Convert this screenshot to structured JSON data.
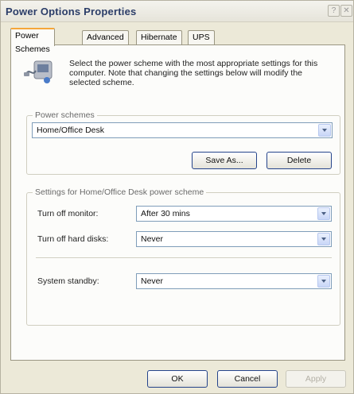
{
  "window": {
    "title": "Power Options Properties",
    "help_glyph": "?",
    "close_glyph": "✕"
  },
  "tabs": [
    {
      "label": "Power Schemes"
    },
    {
      "label": "Advanced"
    },
    {
      "label": "Hibernate"
    },
    {
      "label": "UPS"
    }
  ],
  "intro": {
    "icon": "power-plug-icon",
    "text": "Select the power scheme with the most appropriate settings for this computer. Note that changing the settings below will modify the selected scheme."
  },
  "power_schemes": {
    "group_label": "Power schemes",
    "selected": "Home/Office Desk",
    "save_as_label": "Save As...",
    "delete_label": "Delete"
  },
  "settings": {
    "group_label": "Settings for Home/Office Desk power scheme",
    "turn_off_monitor": {
      "label": "Turn off monitor:",
      "value": "After 30 mins"
    },
    "turn_off_hard_disks": {
      "label": "Turn off hard disks:",
      "value": "Never"
    },
    "system_standby": {
      "label": "System standby:",
      "value": "Never"
    }
  },
  "footer": {
    "ok_label": "OK",
    "cancel_label": "Cancel",
    "apply_label": "Apply"
  },
  "colors": {
    "accent_tab": "#f5a63a",
    "title_text": "#2b3d68",
    "button_border": "#25448b",
    "window_bg": "#ece9d8"
  }
}
